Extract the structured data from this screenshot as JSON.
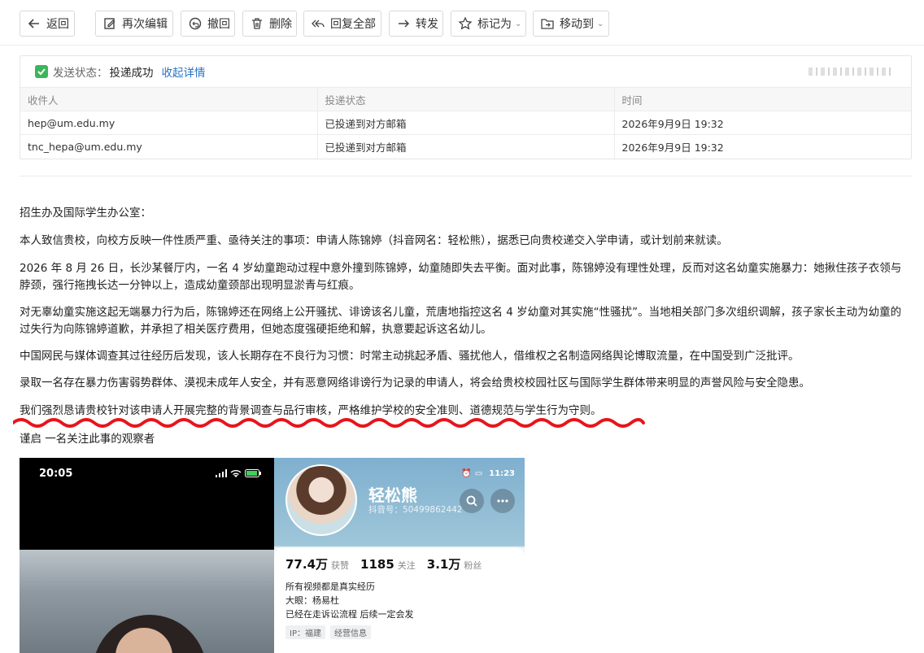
{
  "toolbar": {
    "back": "返回",
    "edit_again": "再次编辑",
    "recall": "撤回",
    "delete": "删除",
    "reply_all": "回复全部",
    "forward": "转发",
    "mark_as": "标记为",
    "move_to": "移动到"
  },
  "delivery": {
    "label": "发送状态：",
    "value": "投递成功",
    "collapse_link": "收起详情",
    "columns": [
      "收件人",
      "投递状态",
      "时间"
    ],
    "rows": [
      [
        "hep@um.edu.my",
        "已投递到对方邮箱",
        "2026年9月9日 19:32"
      ],
      [
        "tnc_hepa@um.edu.my",
        "已投递到对方邮箱",
        "2026年9月9日 19:32"
      ]
    ]
  },
  "body": {
    "greeting": "招生办及国际学生办公室：",
    "p1": "本人致信贵校，向校方反映一件性质严重、亟待关注的事项：申请人陈锦婷（抖音网名：轻松熊），据悉已向贵校递交入学申请，或计划前来就读。",
    "p2": "2026 年 8 月 26 日，长沙某餐厅内，一名 4 岁幼童跑动过程中意外撞到陈锦婷，幼童随即失去平衡。面对此事，陈锦婷没有理性处理，反而对这名幼童实施暴力：她揪住孩子衣领与脖颈，强行拖拽长达一分钟以上，造成幼童颈部出现明显淤青与红痕。",
    "p3": "对无辜幼童实施这起无端暴力行为后，陈锦婷还在网络上公开骚扰、诽谤该名儿童，荒唐地指控这名 4 岁幼童对其实施“性骚扰”。当地相关部门多次组织调解，孩子家长主动为幼童的过失行为向陈锦婷道歉，并承担了相关医疗费用，但她态度强硬拒绝和解，执意要起诉这名幼儿。",
    "p4": "中国网民与媒体调查其过往经历后发现，该人长期存在不良行为习惯：时常主动挑起矛盾、骚扰他人，借维权之名制造网络舆论博取流量，在中国受到广泛批评。",
    "p5": "录取一名存在暴力伤害弱势群体、漠视未成年人安全，并有恶意网络诽谤行为记录的申请人，将会给贵校校园社区与国际学生群体带来明显的声誉风险与安全隐患。",
    "p6": "我们强烈恳请贵校针对该申请人开展完整的背景调查与品行审核，严格维护学校的安全准则、道德规范与学生行为守则。",
    "signoff": "谨启 一名关注此事的观察者"
  },
  "screenshot_left": {
    "time": "20:05"
  },
  "screenshot_right": {
    "time": "11:23",
    "nickname": "轻松熊",
    "uid": "抖音号：50499862442",
    "likes_num": "77.4万",
    "likes_label": "获赞",
    "following_num": "1185",
    "following_label": "关注",
    "fans_num": "3.1万",
    "fans_label": "粉丝",
    "bio_line1": "所有视频都是真实经历",
    "bio_line2": "大眼：杨易杜",
    "bio_line3": "已经在走诉讼流程 后续一定会发",
    "tag_ip": "IP：福建",
    "tag_biz": "经营信息"
  },
  "colors": {
    "accent_link": "#2a73c9",
    "success": "#3cb55a",
    "underline_red": "#e8141c"
  }
}
